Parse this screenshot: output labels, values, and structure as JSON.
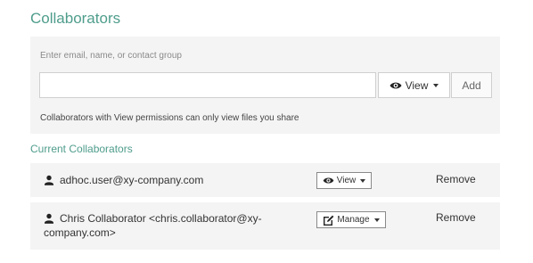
{
  "title": "Collaborators",
  "invite": {
    "label": "Enter email, name, or contact group",
    "input_value": "",
    "input_placeholder": "",
    "permission": {
      "label": "View",
      "icon": "eye-icon"
    },
    "add_label": "Add",
    "permission_note": "Collaborators with View permissions can only view files you share"
  },
  "current": {
    "heading": "Current Collaborators",
    "collaborators": [
      {
        "name_line1": "adhoc.user@xy-company.com",
        "name_line2": "",
        "role": "View",
        "role_icon": "eye-icon",
        "remove_label": "Remove"
      },
      {
        "name_line1": "Chris Collaborator <chris.collaborator@xy-",
        "name_line2": "company.com>",
        "role": "Manage",
        "role_icon": "edit-icon",
        "remove_label": "Remove"
      }
    ]
  },
  "colors": {
    "accent": "#4f9d8c",
    "panel_bg": "#f4f4f4"
  }
}
